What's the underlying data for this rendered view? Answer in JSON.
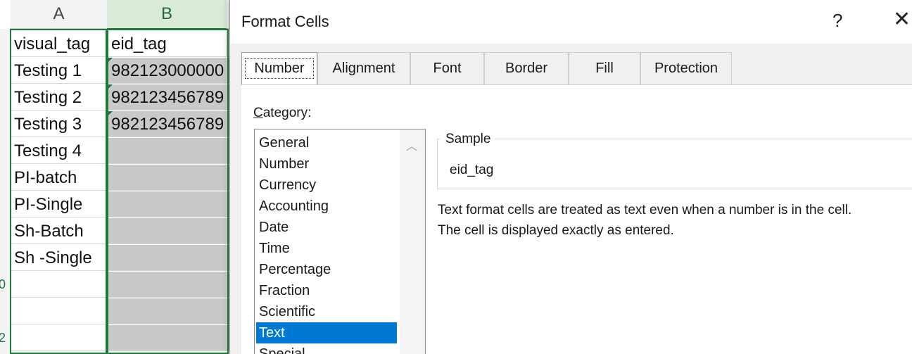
{
  "sheet": {
    "columns": [
      "A",
      "B"
    ],
    "rows": [
      {
        "a": "visual_tag",
        "b": "eid_tag",
        "marker": false
      },
      {
        "a": "Testing 1",
        "b": "982123000000",
        "marker": true
      },
      {
        "a": "Testing 2",
        "b": "982123456789",
        "marker": true
      },
      {
        "a": "Testing 3",
        "b": "982123456789",
        "marker": true
      },
      {
        "a": "Testing 4",
        "b": "",
        "marker": false
      },
      {
        "a": "PI-batch",
        "b": "",
        "marker": false
      },
      {
        "a": "PI-Single",
        "b": "",
        "marker": false
      },
      {
        "a": "Sh-Batch",
        "b": "",
        "marker": false
      },
      {
        "a": "Sh -Single",
        "b": "",
        "marker": false
      },
      {
        "a": "",
        "b": "",
        "marker": false
      },
      {
        "a": "",
        "b": "",
        "marker": false
      },
      {
        "a": "",
        "b": "",
        "marker": false
      }
    ],
    "row_marks": [
      "0",
      "2"
    ]
  },
  "dialog": {
    "title": "Format Cells",
    "help": "?",
    "close": "✕",
    "tabs": [
      "Number",
      "Alignment",
      "Font",
      "Border",
      "Fill",
      "Protection"
    ],
    "active_tab": "Number",
    "category_label_first": "C",
    "category_label_rest": "ategory:",
    "categories": [
      "General",
      "Number",
      "Currency",
      "Accounting",
      "Date",
      "Time",
      "Percentage",
      "Fraction",
      "Scientific",
      "Text",
      "Special"
    ],
    "selected_category": "Text",
    "sample_label": "Sample",
    "sample_value": "eid_tag",
    "description_line1": "Text format cells are treated as text even when a number is in the cell.",
    "description_line2": "The cell is displayed exactly as entered."
  },
  "colors": {
    "accent_green": "#1e7a3c",
    "selection_blue": "#0078d4",
    "selected_cells_grey": "#c9c9c9"
  }
}
